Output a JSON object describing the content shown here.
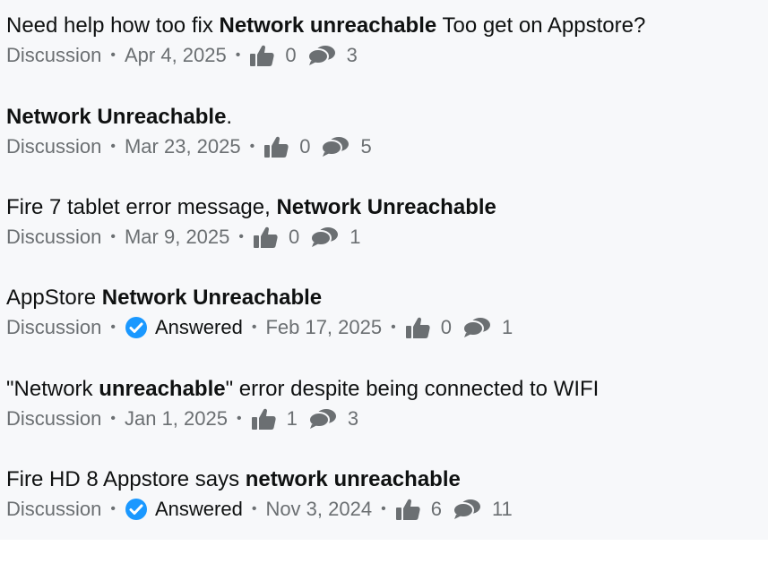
{
  "results": [
    {
      "title_pre": "Need help how too fix ",
      "title_bold": "Network unreachable",
      "title_post": " Too get on Appstore?",
      "type": "Discussion",
      "answered": null,
      "date": "Apr 4, 2025",
      "likes": "0",
      "replies": "3"
    },
    {
      "title_pre": "",
      "title_bold": "Network Unreachable",
      "title_post": ".",
      "type": "Discussion",
      "answered": null,
      "date": "Mar 23, 2025",
      "likes": "0",
      "replies": "5"
    },
    {
      "title_pre": "Fire 7 tablet error message, ",
      "title_bold": "Network Unreachable",
      "title_post": "",
      "type": "Discussion",
      "answered": null,
      "date": "Mar 9, 2025",
      "likes": "0",
      "replies": "1"
    },
    {
      "title_pre": "AppStore ",
      "title_bold": "Network Unreachable",
      "title_post": "",
      "type": "Discussion",
      "answered": "Answered",
      "date": "Feb 17, 2025",
      "likes": "0",
      "replies": "1"
    },
    {
      "title_pre": "\"Network ",
      "title_bold": "unreachable",
      "title_post": "\" error despite being connected to WIFI",
      "type": "Discussion",
      "answered": null,
      "date": "Jan 1, 2025",
      "likes": "1",
      "replies": "3"
    },
    {
      "title_pre": "Fire HD 8 Appstore says ",
      "title_bold": "network unreachable",
      "title_post": "",
      "type": "Discussion",
      "answered": "Answered",
      "date": "Nov 3, 2024",
      "likes": "6",
      "replies": "11"
    }
  ],
  "separator": "•",
  "icons": {
    "like": "thumbs-up-icon",
    "replies": "speech-bubbles-icon",
    "answered": "check-badge-icon"
  },
  "colors": {
    "panel_background": "#f7f8fa",
    "title_text": "#0f1111",
    "meta_text": "#6b6f72",
    "icon_gray": "#6b6f72",
    "answered_badge": "#1a98ff"
  }
}
